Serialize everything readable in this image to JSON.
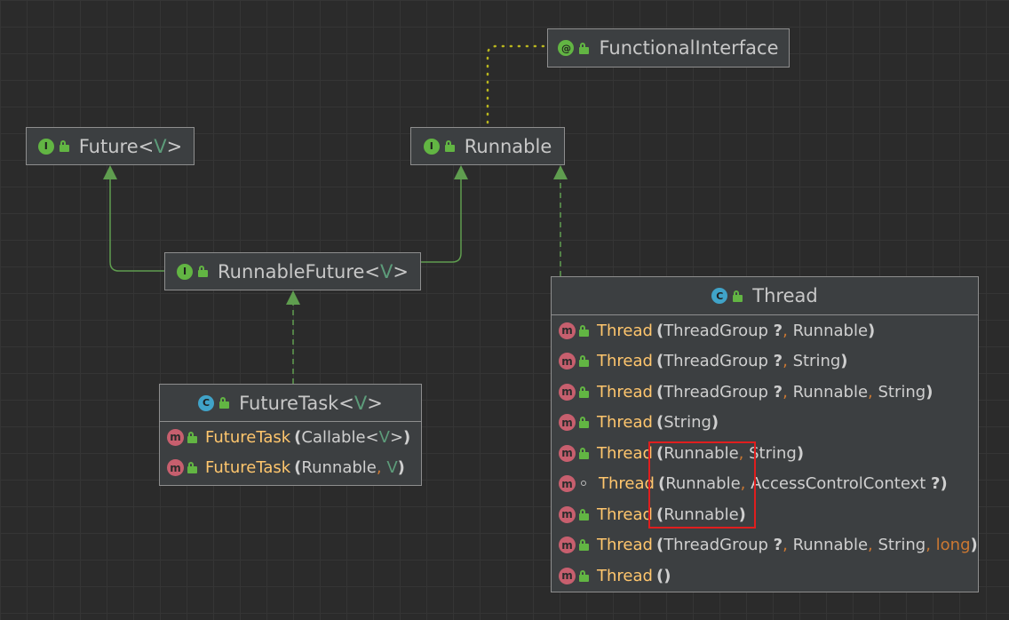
{
  "nodes": {
    "functional_interface": {
      "kind": "@",
      "name": "FunctionalInterface"
    },
    "future": {
      "kind": "I",
      "name": "Future",
      "type_param": "V"
    },
    "runnable": {
      "kind": "I",
      "name": "Runnable"
    },
    "runnable_future": {
      "kind": "I",
      "name": "RunnableFuture",
      "type_param": "V"
    },
    "future_task": {
      "kind": "C",
      "name": "FutureTask",
      "type_param": "V",
      "members": [
        {
          "badge": "m",
          "name": "FutureTask",
          "params": [
            "Callable<V>"
          ]
        },
        {
          "badge": "m",
          "name": "FutureTask",
          "params": [
            "Runnable",
            "V"
          ]
        }
      ]
    },
    "thread": {
      "kind": "C",
      "name": "Thread",
      "members": [
        {
          "badge": "m",
          "name": "Thread",
          "params": [
            "ThreadGroup ?",
            "Runnable"
          ]
        },
        {
          "badge": "m",
          "name": "Thread",
          "params": [
            "ThreadGroup ?",
            "String"
          ]
        },
        {
          "badge": "m",
          "name": "Thread",
          "params": [
            "ThreadGroup ?",
            "Runnable",
            "String"
          ]
        },
        {
          "badge": "m",
          "name": "Thread",
          "params": [
            "String"
          ]
        },
        {
          "badge": "m",
          "name": "Thread",
          "params": [
            "Runnable",
            "String"
          ]
        },
        {
          "badge": "m",
          "name": "Thread",
          "params": [
            "Runnable",
            "AccessControlContext ?"
          ],
          "visibility": "package"
        },
        {
          "badge": "m",
          "name": "Thread",
          "params": [
            "Runnable"
          ]
        },
        {
          "badge": "m",
          "name": "Thread",
          "params": [
            "ThreadGroup ?",
            "Runnable",
            "String",
            "long"
          ]
        },
        {
          "badge": "m",
          "name": "Thread",
          "params": []
        }
      ]
    }
  },
  "colors": {
    "background": "#2b2b2b",
    "node_fill": "#3c3f41",
    "extends_edge": "#5f9d4f",
    "annotation_edge": "#b8b51e",
    "method_name": "#ffc66d",
    "separator": "#cc7832",
    "highlight": "#e01e1e"
  }
}
